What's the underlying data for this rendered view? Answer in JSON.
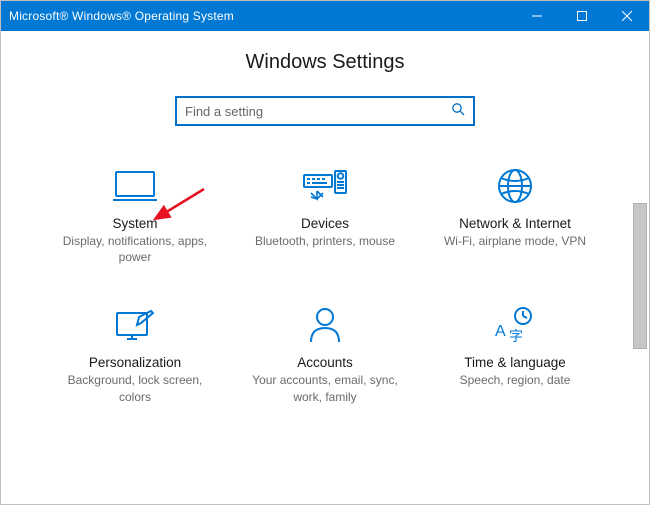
{
  "window": {
    "title": "Microsoft® Windows® Operating System"
  },
  "page": {
    "heading": "Windows Settings"
  },
  "search": {
    "placeholder": "Find a setting"
  },
  "tiles": [
    {
      "label": "System",
      "desc": "Display, notifications, apps,\npower"
    },
    {
      "label": "Devices",
      "desc": "Bluetooth, printers, mouse"
    },
    {
      "label": "Network & Internet",
      "desc": "Wi-Fi, airplane mode, VPN"
    },
    {
      "label": "Personalization",
      "desc": "Background, lock screen,\ncolors"
    },
    {
      "label": "Accounts",
      "desc": "Your accounts, email, sync,\nwork, family"
    },
    {
      "label": "Time & language",
      "desc": "Speech, region, date"
    }
  ]
}
